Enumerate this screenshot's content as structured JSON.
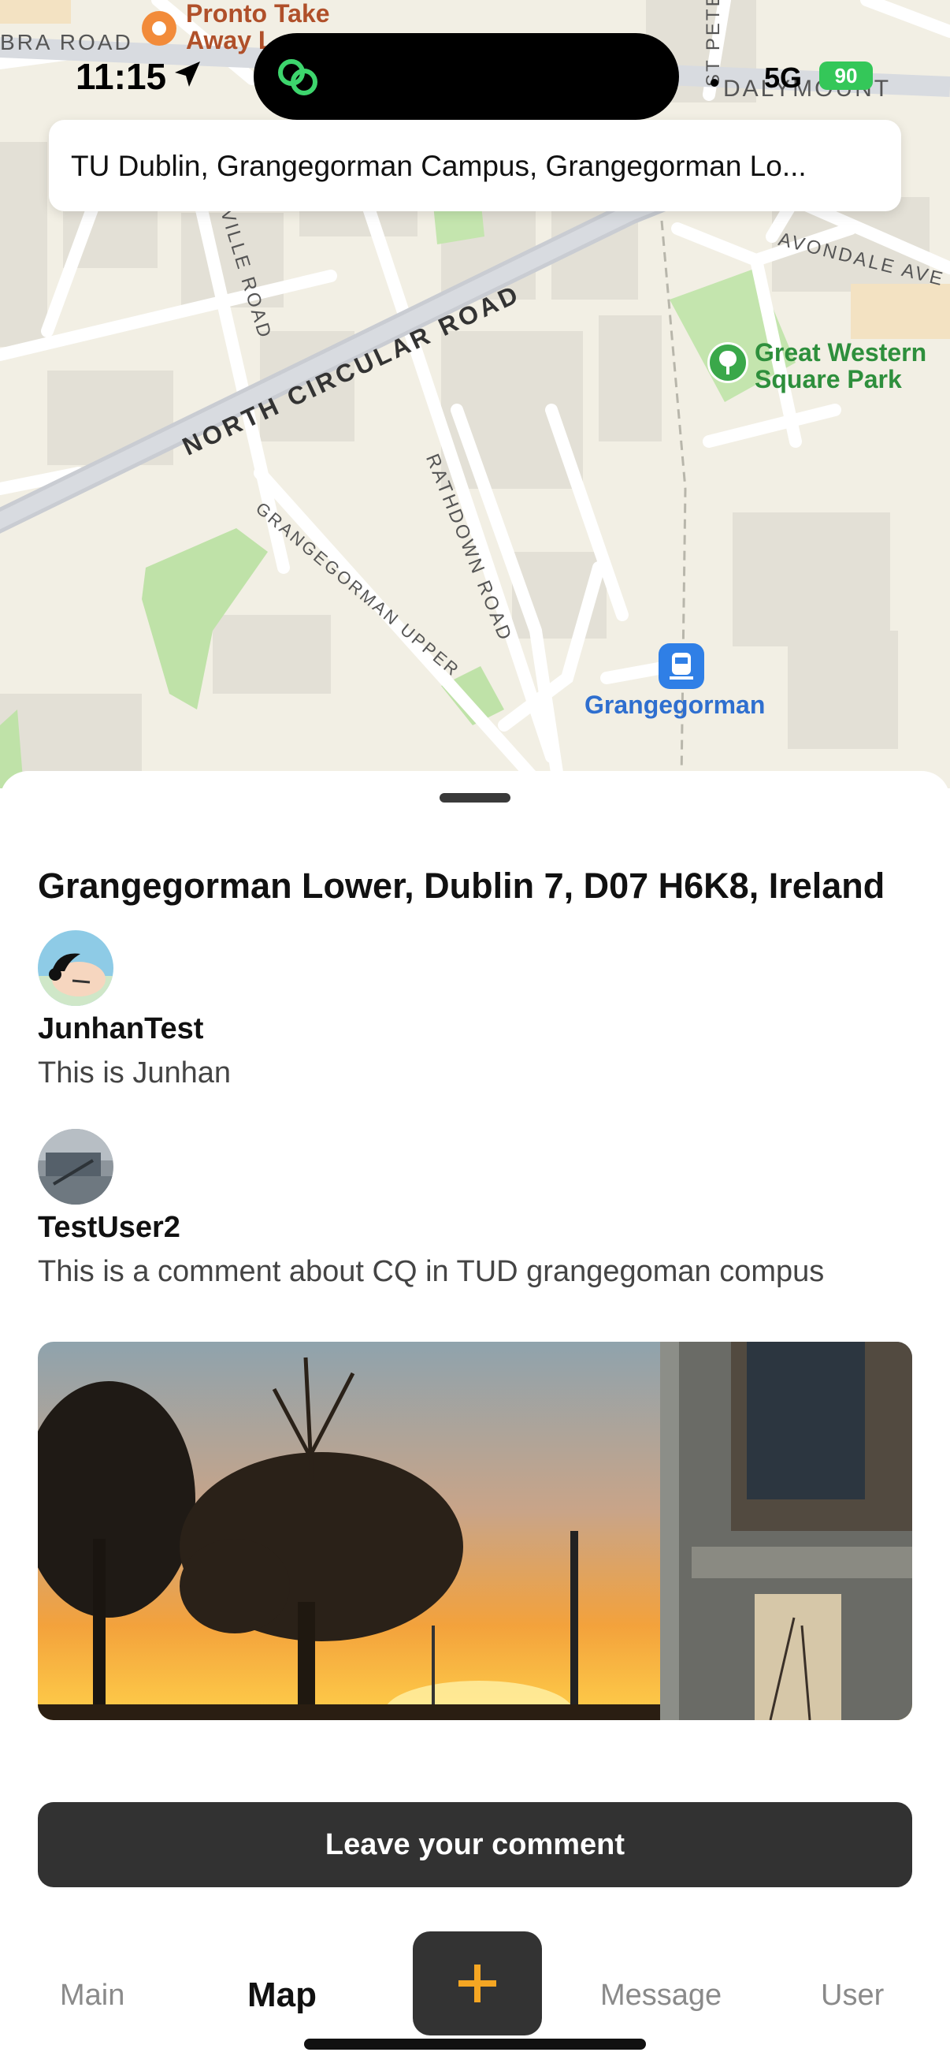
{
  "status_bar": {
    "time": "11:15",
    "network": "5G",
    "battery": "90"
  },
  "search": {
    "text": "TU Dublin, Grangegorman Campus, Grangegorman Lo..."
  },
  "map": {
    "labels": {
      "ra_road": "BRA ROAD",
      "pronto_line1": "Pronto Take",
      "pronto_line2": "Away L",
      "st_peter": "ST PETE",
      "dalymount": "DALYMOUNT",
      "avondale": "AVONDALE AVE",
      "ville_road": "VILLE ROAD",
      "north_circular": "NORTH CIRCULAR ROAD",
      "park_line1": "Great Western",
      "park_line2": "Square Park",
      "rathdown": "RATHDOWN ROAD",
      "grangegorman_upper": "GRANGEGORMAN UPPER",
      "station": "Grangegorman"
    }
  },
  "sheet": {
    "address": "Grangegorman Lower, Dublin 7, D07 H6K8, Ireland",
    "comments": [
      {
        "user": "JunhanTest",
        "text": "This is Junhan"
      },
      {
        "user": "TestUser2",
        "text": "This is a comment about CQ in TUD grangegoman compus"
      }
    ],
    "leave_comment_label": "Leave your comment"
  },
  "tabs": {
    "main": "Main",
    "map": "Map",
    "add": "+",
    "message": "Message",
    "user": "User"
  },
  "colors": {
    "accent": "#f5a623",
    "dark_button": "#323232",
    "park_green": "#2e8f3c"
  }
}
